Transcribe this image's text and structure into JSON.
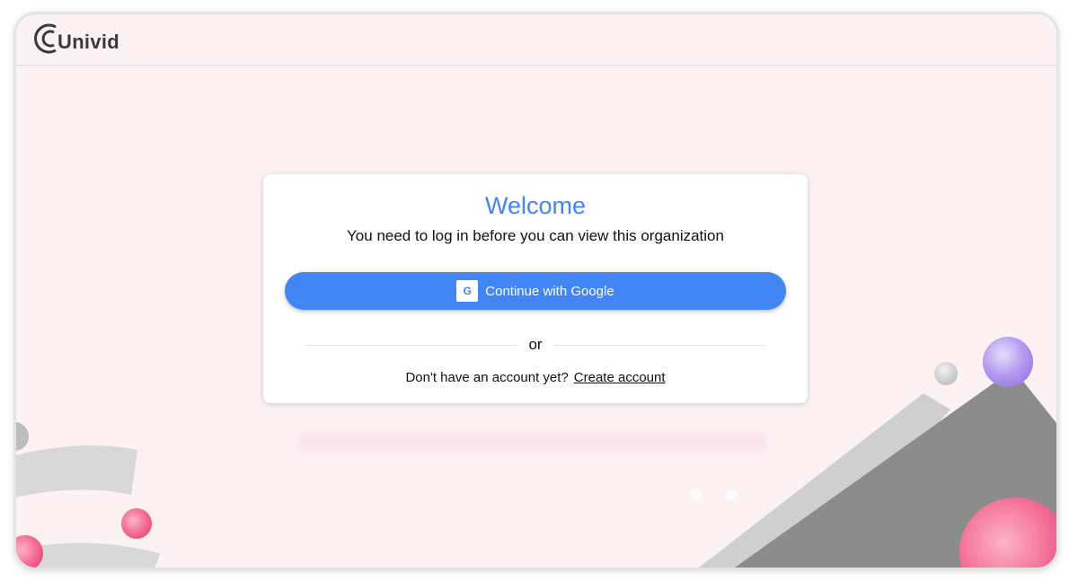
{
  "brand": {
    "name": "Univid"
  },
  "card": {
    "title": "Welcome",
    "subtitle": "You need to log in before you can view this organization",
    "google_button_label": "Continue with Google",
    "google_icon_letter": "G",
    "divider_text": "or",
    "signup_prompt": "Don't have an account yet?",
    "signup_link": "Create account"
  },
  "colors": {
    "accent": "#4285f4",
    "background": "#fcf1f3"
  },
  "icons": {
    "logo": "univid-logo-icon",
    "google": "google-icon"
  }
}
